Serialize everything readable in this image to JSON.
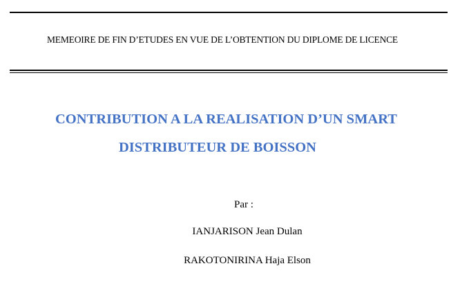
{
  "document": {
    "header": "MEMEOIRE DE FIN D’ETUDES EN VUE DE L’OBTENTION DU DIPLOME DE LICENCE",
    "title_line_1": "CONTRIBUTION A LA REALISATION D’UN SMART",
    "title_line_2": "DISTRIBUTEUR DE BOISSON",
    "by_label": "Par :",
    "authors": [
      "IANJARISON Jean Dulan",
      "RAKOTONIRINA Haja Elson"
    ],
    "title_color": "#4472c4"
  }
}
